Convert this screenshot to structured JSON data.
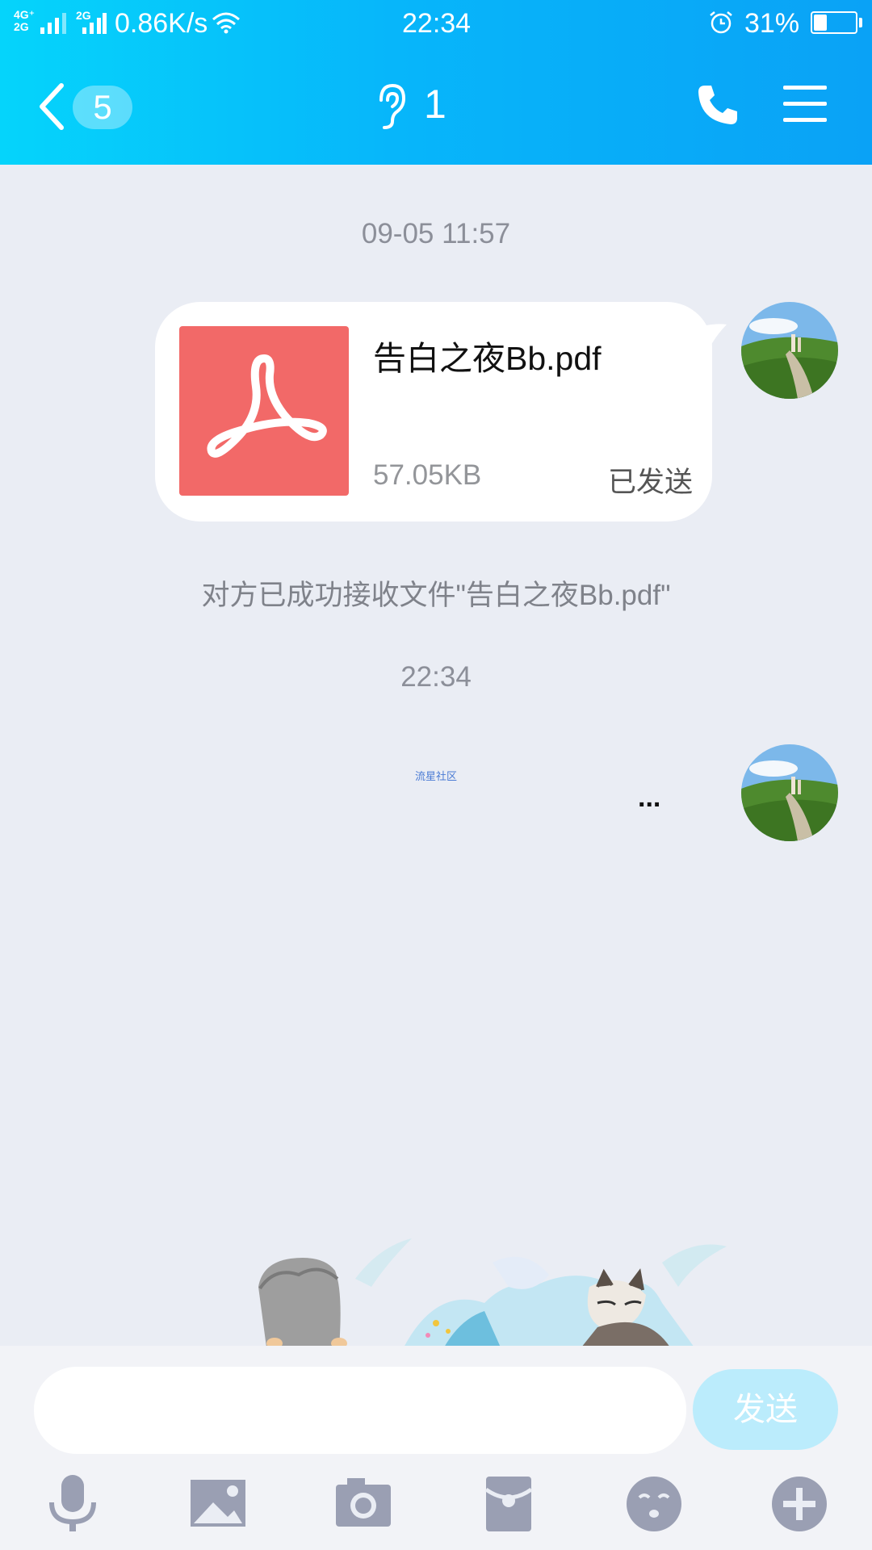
{
  "status_bar": {
    "network_top": "4G⁺",
    "network_bottom": "2G",
    "network2": "2G",
    "speed": "0.86K/s",
    "time": "22:34",
    "battery": "31%",
    "battery_level": 0.31
  },
  "header": {
    "unread_count": "5",
    "title": "1"
  },
  "messages": {
    "timestamp1": "09-05 11:57",
    "file": {
      "name": "告白之夜Bb.pdf",
      "size": "57.05KB",
      "status": "已发送"
    },
    "notice": "对方已成功接收文件\"告白之夜Bb.pdf\"",
    "timestamp2": "22:34",
    "watermark": "流星社区",
    "typing": "..."
  },
  "input": {
    "value": "",
    "send_label": "发送"
  },
  "toolbar": [
    "microphone-icon",
    "image-icon",
    "camera-icon",
    "red-packet-icon",
    "emoji-icon",
    "plus-icon"
  ],
  "colors": {
    "header_start": "#05d4fb",
    "header_end": "#0aa2f6",
    "pdf_red": "#f26968",
    "send_disabled": "#bbecfc",
    "toolbar_icon": "#9a9fb3"
  }
}
